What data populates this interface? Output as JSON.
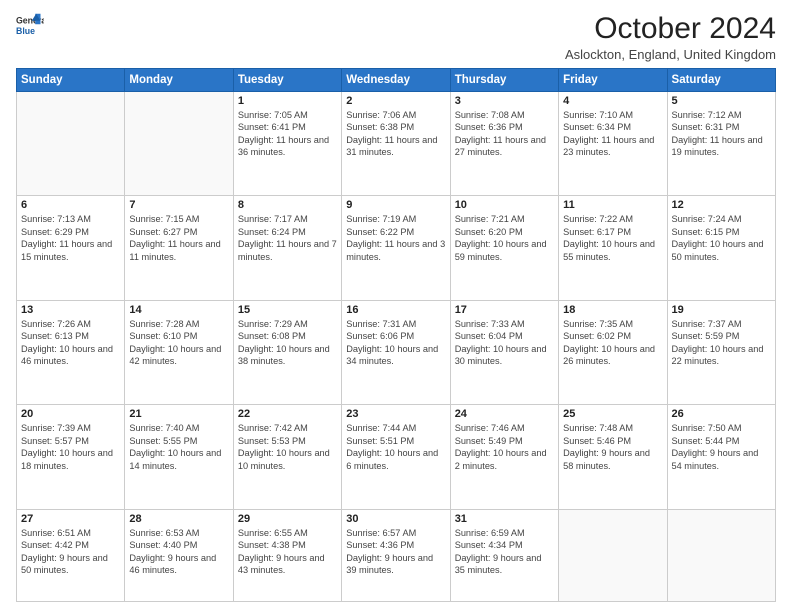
{
  "logo": {
    "line1": "General",
    "line2": "Blue"
  },
  "title": "October 2024",
  "subtitle": "Aslockton, England, United Kingdom",
  "days_of_week": [
    "Sunday",
    "Monday",
    "Tuesday",
    "Wednesday",
    "Thursday",
    "Friday",
    "Saturday"
  ],
  "weeks": [
    [
      {
        "day": "",
        "sunrise": "",
        "sunset": "",
        "daylight": "",
        "empty": true
      },
      {
        "day": "",
        "sunrise": "",
        "sunset": "",
        "daylight": "",
        "empty": true
      },
      {
        "day": "1",
        "sunrise": "Sunrise: 7:05 AM",
        "sunset": "Sunset: 6:41 PM",
        "daylight": "Daylight: 11 hours and 36 minutes."
      },
      {
        "day": "2",
        "sunrise": "Sunrise: 7:06 AM",
        "sunset": "Sunset: 6:38 PM",
        "daylight": "Daylight: 11 hours and 31 minutes."
      },
      {
        "day": "3",
        "sunrise": "Sunrise: 7:08 AM",
        "sunset": "Sunset: 6:36 PM",
        "daylight": "Daylight: 11 hours and 27 minutes."
      },
      {
        "day": "4",
        "sunrise": "Sunrise: 7:10 AM",
        "sunset": "Sunset: 6:34 PM",
        "daylight": "Daylight: 11 hours and 23 minutes."
      },
      {
        "day": "5",
        "sunrise": "Sunrise: 7:12 AM",
        "sunset": "Sunset: 6:31 PM",
        "daylight": "Daylight: 11 hours and 19 minutes."
      }
    ],
    [
      {
        "day": "6",
        "sunrise": "Sunrise: 7:13 AM",
        "sunset": "Sunset: 6:29 PM",
        "daylight": "Daylight: 11 hours and 15 minutes."
      },
      {
        "day": "7",
        "sunrise": "Sunrise: 7:15 AM",
        "sunset": "Sunset: 6:27 PM",
        "daylight": "Daylight: 11 hours and 11 minutes."
      },
      {
        "day": "8",
        "sunrise": "Sunrise: 7:17 AM",
        "sunset": "Sunset: 6:24 PM",
        "daylight": "Daylight: 11 hours and 7 minutes."
      },
      {
        "day": "9",
        "sunrise": "Sunrise: 7:19 AM",
        "sunset": "Sunset: 6:22 PM",
        "daylight": "Daylight: 11 hours and 3 minutes."
      },
      {
        "day": "10",
        "sunrise": "Sunrise: 7:21 AM",
        "sunset": "Sunset: 6:20 PM",
        "daylight": "Daylight: 10 hours and 59 minutes."
      },
      {
        "day": "11",
        "sunrise": "Sunrise: 7:22 AM",
        "sunset": "Sunset: 6:17 PM",
        "daylight": "Daylight: 10 hours and 55 minutes."
      },
      {
        "day": "12",
        "sunrise": "Sunrise: 7:24 AM",
        "sunset": "Sunset: 6:15 PM",
        "daylight": "Daylight: 10 hours and 50 minutes."
      }
    ],
    [
      {
        "day": "13",
        "sunrise": "Sunrise: 7:26 AM",
        "sunset": "Sunset: 6:13 PM",
        "daylight": "Daylight: 10 hours and 46 minutes."
      },
      {
        "day": "14",
        "sunrise": "Sunrise: 7:28 AM",
        "sunset": "Sunset: 6:10 PM",
        "daylight": "Daylight: 10 hours and 42 minutes."
      },
      {
        "day": "15",
        "sunrise": "Sunrise: 7:29 AM",
        "sunset": "Sunset: 6:08 PM",
        "daylight": "Daylight: 10 hours and 38 minutes."
      },
      {
        "day": "16",
        "sunrise": "Sunrise: 7:31 AM",
        "sunset": "Sunset: 6:06 PM",
        "daylight": "Daylight: 10 hours and 34 minutes."
      },
      {
        "day": "17",
        "sunrise": "Sunrise: 7:33 AM",
        "sunset": "Sunset: 6:04 PM",
        "daylight": "Daylight: 10 hours and 30 minutes."
      },
      {
        "day": "18",
        "sunrise": "Sunrise: 7:35 AM",
        "sunset": "Sunset: 6:02 PM",
        "daylight": "Daylight: 10 hours and 26 minutes."
      },
      {
        "day": "19",
        "sunrise": "Sunrise: 7:37 AM",
        "sunset": "Sunset: 5:59 PM",
        "daylight": "Daylight: 10 hours and 22 minutes."
      }
    ],
    [
      {
        "day": "20",
        "sunrise": "Sunrise: 7:39 AM",
        "sunset": "Sunset: 5:57 PM",
        "daylight": "Daylight: 10 hours and 18 minutes."
      },
      {
        "day": "21",
        "sunrise": "Sunrise: 7:40 AM",
        "sunset": "Sunset: 5:55 PM",
        "daylight": "Daylight: 10 hours and 14 minutes."
      },
      {
        "day": "22",
        "sunrise": "Sunrise: 7:42 AM",
        "sunset": "Sunset: 5:53 PM",
        "daylight": "Daylight: 10 hours and 10 minutes."
      },
      {
        "day": "23",
        "sunrise": "Sunrise: 7:44 AM",
        "sunset": "Sunset: 5:51 PM",
        "daylight": "Daylight: 10 hours and 6 minutes."
      },
      {
        "day": "24",
        "sunrise": "Sunrise: 7:46 AM",
        "sunset": "Sunset: 5:49 PM",
        "daylight": "Daylight: 10 hours and 2 minutes."
      },
      {
        "day": "25",
        "sunrise": "Sunrise: 7:48 AM",
        "sunset": "Sunset: 5:46 PM",
        "daylight": "Daylight: 9 hours and 58 minutes."
      },
      {
        "day": "26",
        "sunrise": "Sunrise: 7:50 AM",
        "sunset": "Sunset: 5:44 PM",
        "daylight": "Daylight: 9 hours and 54 minutes."
      }
    ],
    [
      {
        "day": "27",
        "sunrise": "Sunrise: 6:51 AM",
        "sunset": "Sunset: 4:42 PM",
        "daylight": "Daylight: 9 hours and 50 minutes."
      },
      {
        "day": "28",
        "sunrise": "Sunrise: 6:53 AM",
        "sunset": "Sunset: 4:40 PM",
        "daylight": "Daylight: 9 hours and 46 minutes."
      },
      {
        "day": "29",
        "sunrise": "Sunrise: 6:55 AM",
        "sunset": "Sunset: 4:38 PM",
        "daylight": "Daylight: 9 hours and 43 minutes."
      },
      {
        "day": "30",
        "sunrise": "Sunrise: 6:57 AM",
        "sunset": "Sunset: 4:36 PM",
        "daylight": "Daylight: 9 hours and 39 minutes."
      },
      {
        "day": "31",
        "sunrise": "Sunrise: 6:59 AM",
        "sunset": "Sunset: 4:34 PM",
        "daylight": "Daylight: 9 hours and 35 minutes."
      },
      {
        "day": "",
        "sunrise": "",
        "sunset": "",
        "daylight": "",
        "empty": true
      },
      {
        "day": "",
        "sunrise": "",
        "sunset": "",
        "daylight": "",
        "empty": true
      }
    ]
  ]
}
